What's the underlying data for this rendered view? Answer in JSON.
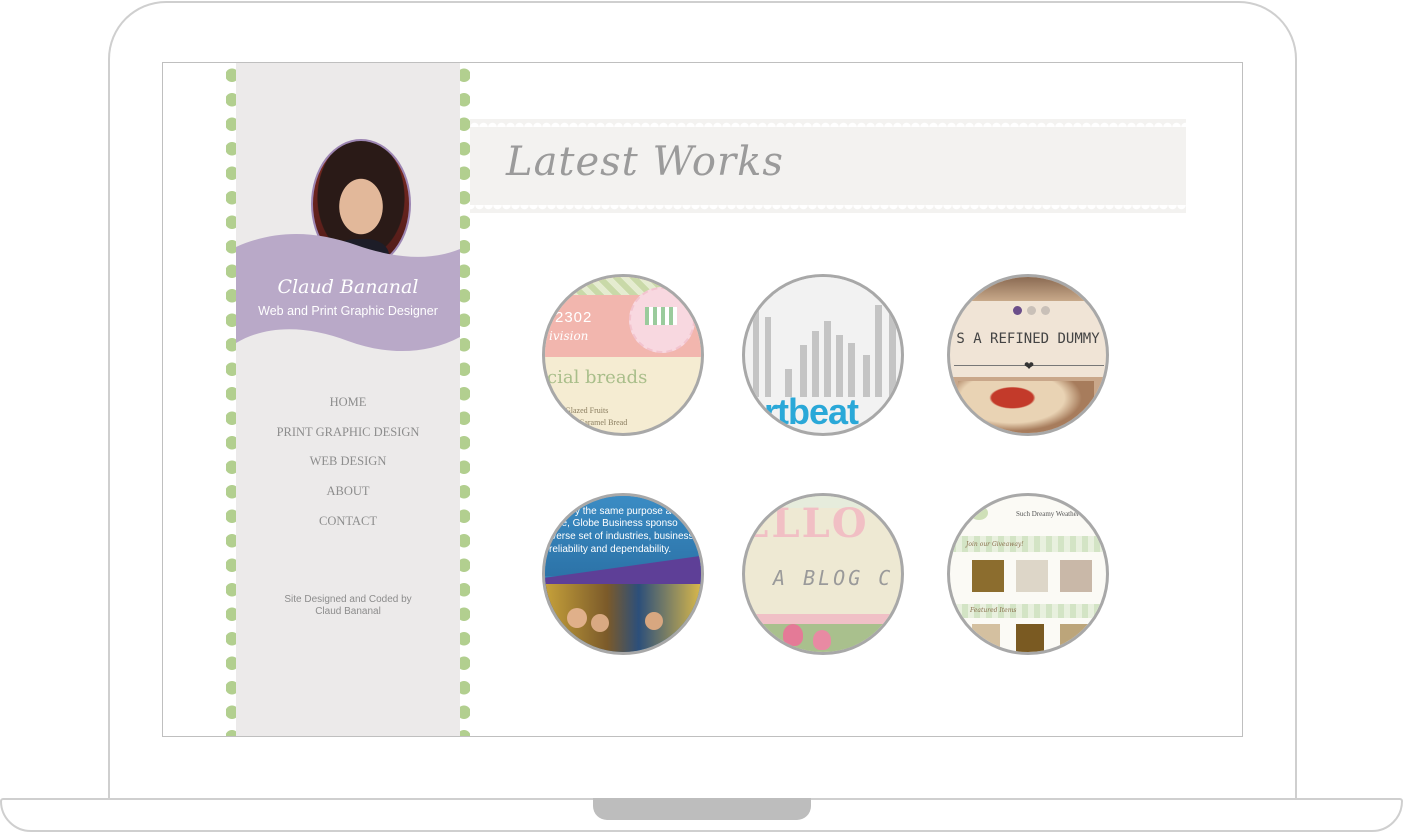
{
  "profile": {
    "name": "Claud Bananal",
    "title": "Web and Print Graphic Designer"
  },
  "nav": {
    "items": [
      "HOME",
      "PRINT GRAPHIC DESIGN",
      "WEB DESIGN",
      "ABOUT",
      "CONTACT"
    ]
  },
  "footer": {
    "credit_line1": "Site Designed and Coded by",
    "credit_line2": "Claud Bananal"
  },
  "main": {
    "title": "Latest Works"
  },
  "works": {
    "t1": {
      "code": "2302",
      "sub": "ivision",
      "headline": "cial breads",
      "line1": "h Glazed Fruits",
      "line2": "Caramel Bread"
    },
    "t2": {
      "brand": "artbeat"
    },
    "t3": {
      "headline": "S A REFINED DUMMY"
    },
    "t4": {
      "line1": "y the same purpose a",
      "line2": "ase, Globe Business sponso",
      "line3": "iverse set of industries, businesses",
      "line4": "reliability and dependability."
    },
    "t5": {
      "big": "ELLO",
      "sub": "A BLOG C"
    },
    "t6": {
      "title": "Such Dreamy Weather",
      "join": "Join our Giveaway!",
      "featured": "Featured Items"
    }
  },
  "colors": {
    "scallop_green": "#b2cf8f",
    "sidebar_bg": "#eceaea",
    "lavender": "#b9a9c8",
    "nav_text": "#8d8d8d",
    "heading_text": "#9b9b9b"
  }
}
